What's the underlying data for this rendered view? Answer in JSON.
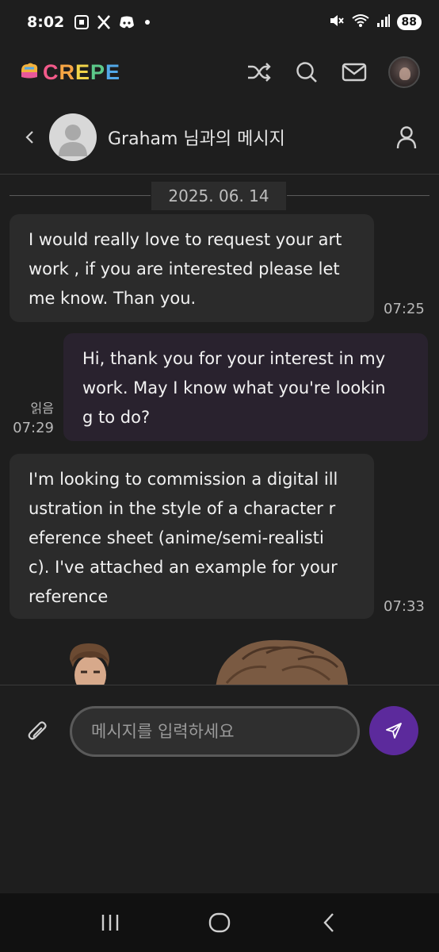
{
  "status_bar": {
    "time": "8:02",
    "battery": "88",
    "notification_icons": [
      "screenshot-icon",
      "x-icon",
      "discord-icon",
      "dot-icon"
    ],
    "system_icons": [
      "mute-icon",
      "wifi-icon",
      "signal-icon",
      "battery-icon"
    ]
  },
  "app_header": {
    "logo_text": "CREPE",
    "logo_colors": [
      "#f25a8a",
      "#f7a544",
      "#f2d449",
      "#5cc98a",
      "#52a8e8",
      "#9b7be8"
    ],
    "actions": [
      "shuffle-icon",
      "search-icon",
      "mail-icon",
      "user-avatar"
    ]
  },
  "chat_header": {
    "title": "Graham 님과의 메시지"
  },
  "chat": {
    "date": "2025. 06. 14",
    "messages": [
      {
        "direction": "in",
        "lines": [
          "I would really love to request your art",
          "work , if you are interested please let",
          "me know. Than you."
        ],
        "time": "07:25"
      },
      {
        "direction": "out",
        "lines": [
          "Hi, thank you for your interest in my",
          "work. May I know what you're lookin",
          "g to do?"
        ],
        "read_label": "읽음",
        "time": "07:29"
      },
      {
        "direction": "in",
        "lines": [
          "I'm looking to commission a digital ill",
          "ustration in the style of a character r",
          "eference sheet (anime/semi-realisti",
          "c). I've attached an example for your",
          "reference"
        ],
        "time": "07:33"
      }
    ]
  },
  "composer": {
    "placeholder": "메시지를 입력하세요",
    "send_color": "#5c2a9c"
  },
  "colors": {
    "background": "#1e1e1e",
    "bubble_in": "#2b2b2b",
    "bubble_out": "#29222e",
    "accent": "#5c2a9c"
  }
}
